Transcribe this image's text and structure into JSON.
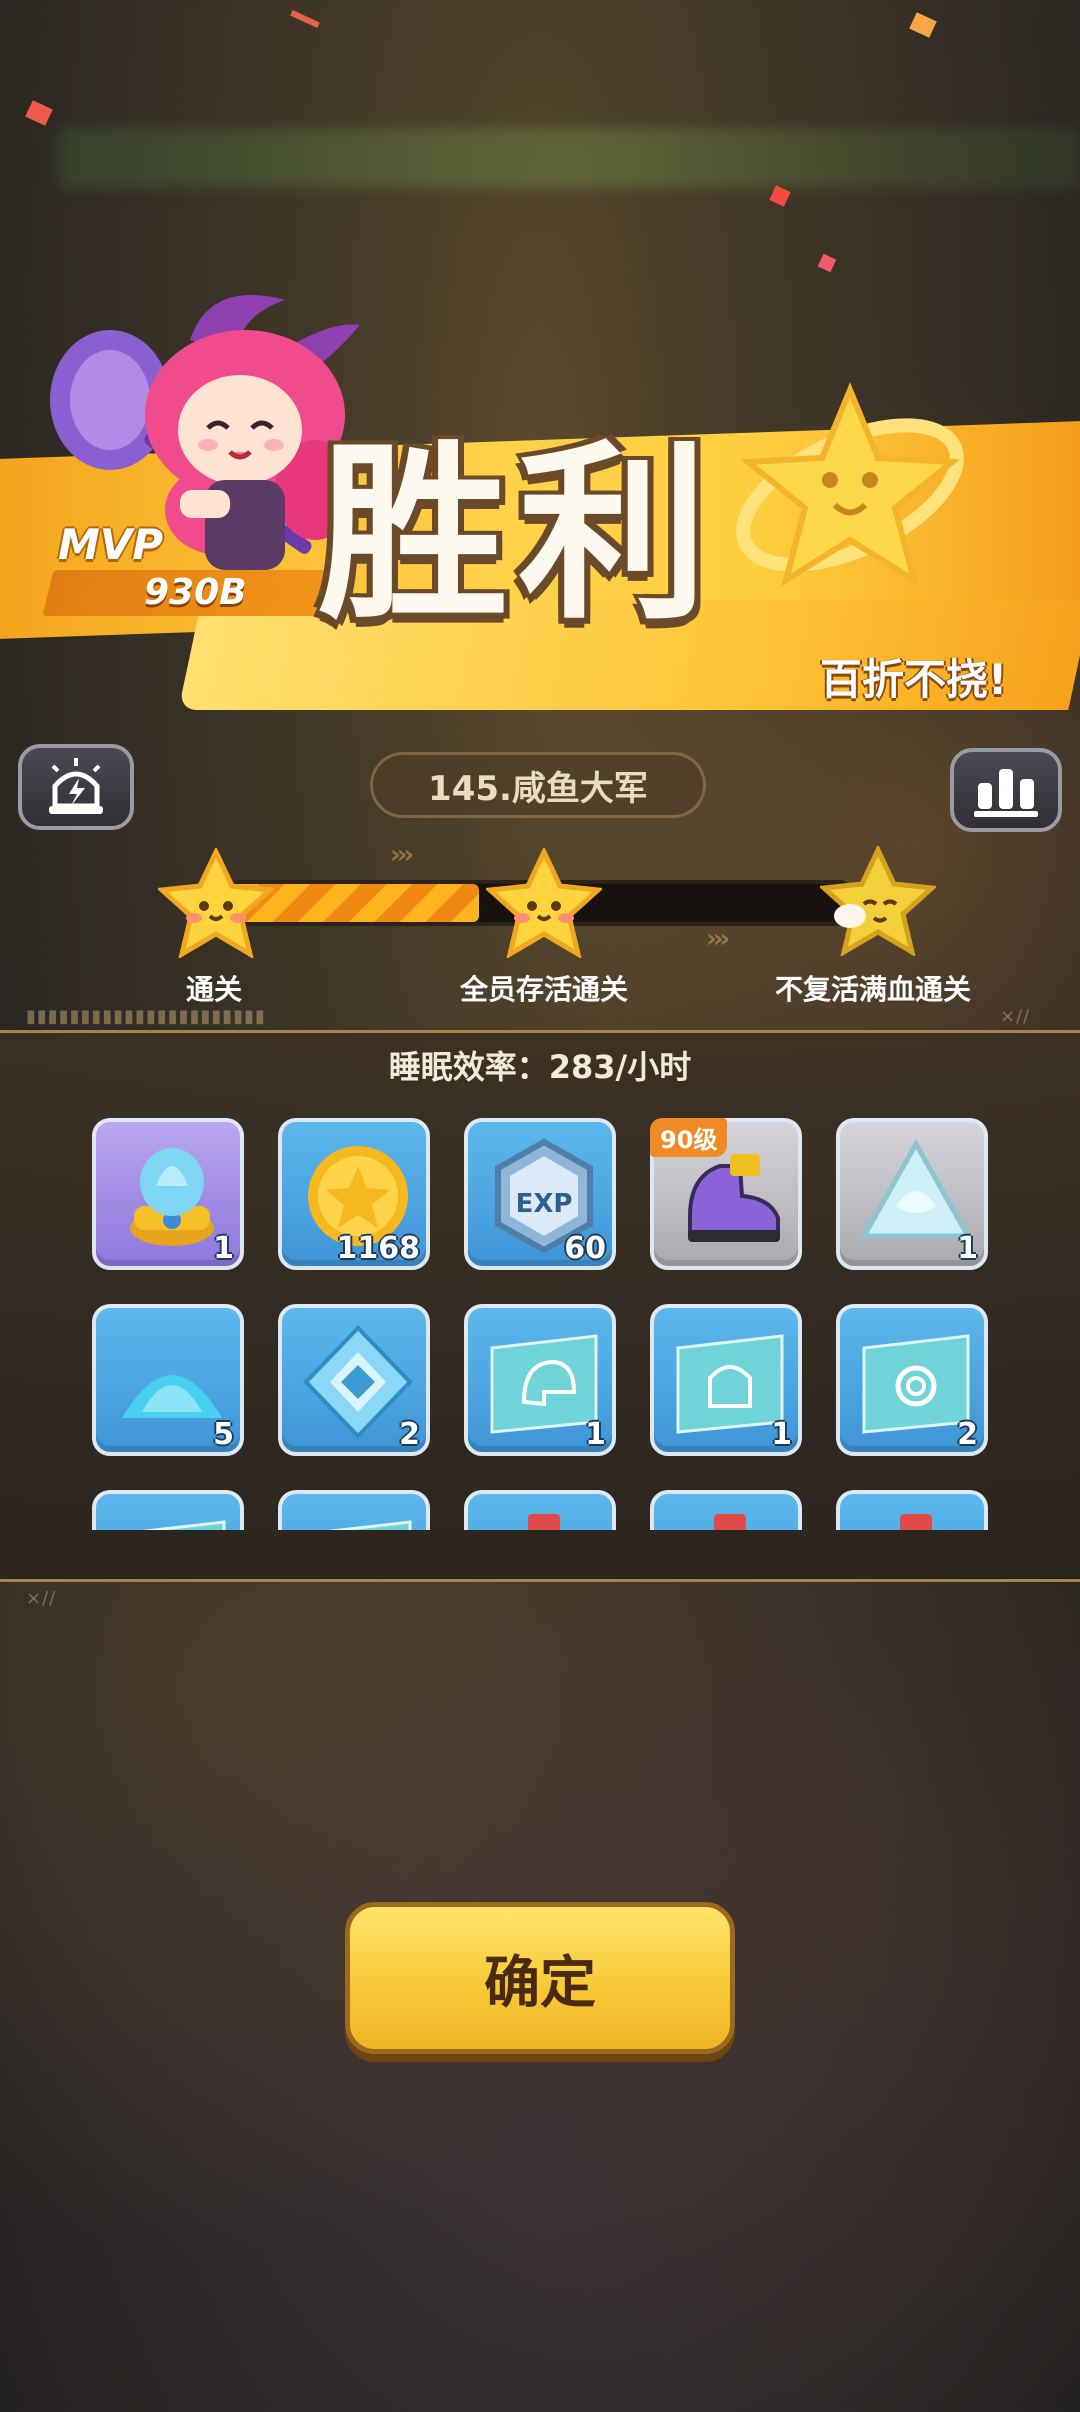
{
  "mvp": {
    "label": "MVP",
    "score": "930B"
  },
  "victory": {
    "title": "胜利",
    "subtitle": "百折不挠!"
  },
  "level": {
    "name": "145.咸鱼大军"
  },
  "progress": {
    "fill_fraction": 0.4,
    "nodes": [
      {
        "label": "通关",
        "achieved": true
      },
      {
        "label": "全员存活通关",
        "achieved": true
      },
      {
        "label": "不复活满血通关",
        "achieved": false
      }
    ]
  },
  "rewards": {
    "sleep_rate": "睡眠效率：283/小时",
    "items": [
      {
        "icon": "blue-flame-capsule-icon",
        "qty": "1",
        "bg": "purple"
      },
      {
        "icon": "gold-coin-icon",
        "qty": "1168",
        "bg": "blue"
      },
      {
        "icon": "exp-badge-icon",
        "qty": "60",
        "bg": "blue"
      },
      {
        "icon": "purple-shoe-icon",
        "qty": "",
        "badge": "90级",
        "bg": "gray"
      },
      {
        "icon": "ice-glove-shard-icon",
        "qty": "1",
        "bg": "gray"
      },
      {
        "icon": "blue-powder-icon",
        "qty": "5",
        "bg": "blue"
      },
      {
        "icon": "blue-diamond-icon",
        "qty": "2",
        "bg": "blue"
      },
      {
        "icon": "helmet-blueprint-icon",
        "qty": "1",
        "bg": "blue"
      },
      {
        "icon": "armor-blueprint-icon",
        "qty": "1",
        "bg": "blue"
      },
      {
        "icon": "ring-blueprint-icon",
        "qty": "2",
        "bg": "blue"
      },
      {
        "icon": "blueprint-icon",
        "qty": "",
        "bg": "blue"
      },
      {
        "icon": "blueprint-icon",
        "qty": "",
        "bg": "blue"
      },
      {
        "icon": "potion-bottle-icon",
        "qty": "",
        "bg": "blue"
      },
      {
        "icon": "potion-bottle-icon",
        "qty": "",
        "bg": "blue"
      },
      {
        "icon": "potion-bottle-icon",
        "qty": "",
        "bg": "blue"
      }
    ]
  },
  "confirm_label": "确定",
  "colors": {
    "accent": "#f7c735",
    "banner": "#ffc738",
    "item_blue": "#4aa3e0"
  }
}
